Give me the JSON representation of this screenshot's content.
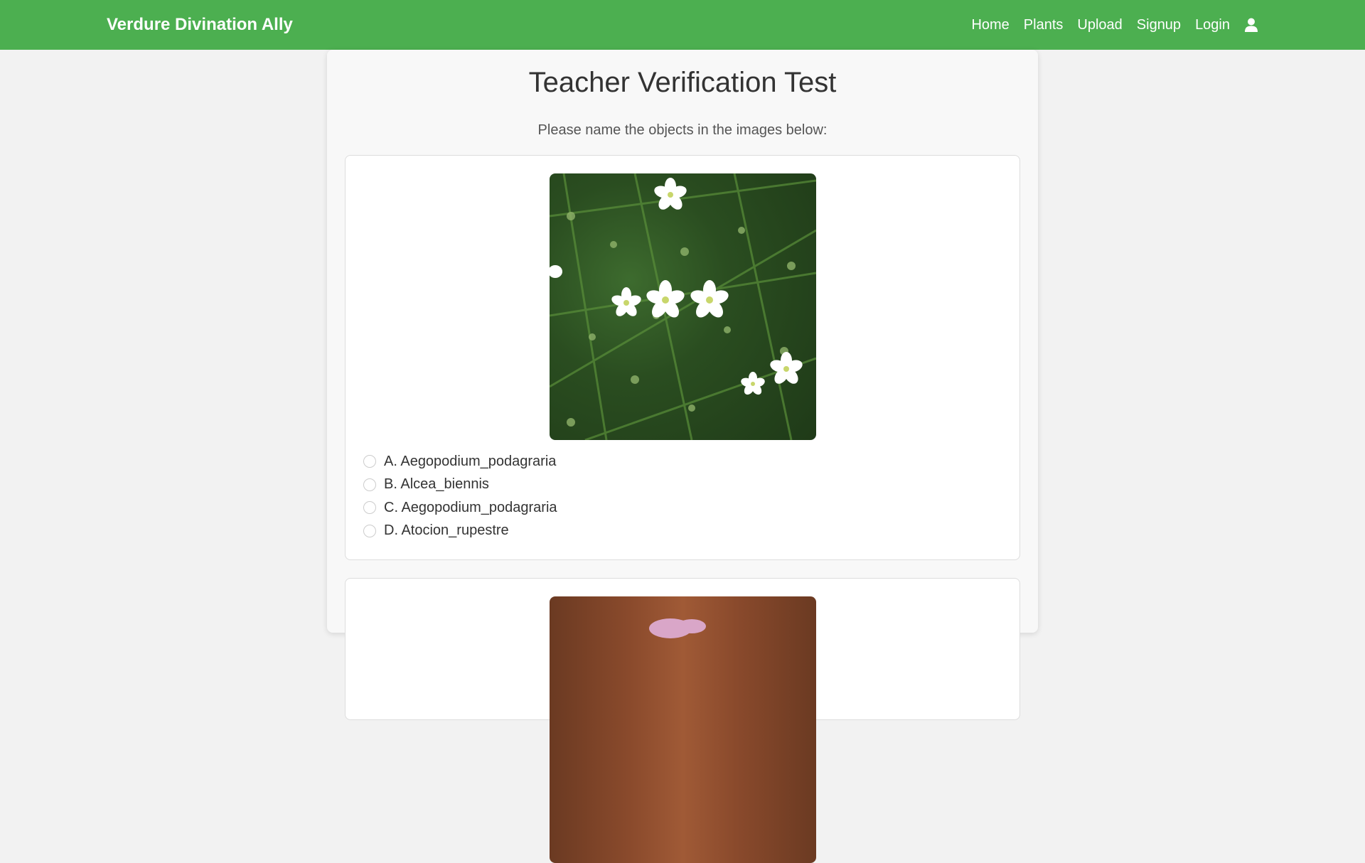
{
  "app": {
    "brand": "Verdure Divination Ally"
  },
  "nav": {
    "items": [
      {
        "label": "Home"
      },
      {
        "label": "Plants"
      },
      {
        "label": "Upload"
      },
      {
        "label": "Signup"
      },
      {
        "label": "Login"
      }
    ],
    "user_icon": "user-icon"
  },
  "page": {
    "title": "Teacher Verification Test",
    "subtitle": "Please name the objects in the images below:"
  },
  "questions": [
    {
      "image_icon": "white-flowers-photo",
      "options": [
        {
          "label": "A. Aegopodium_podagraria"
        },
        {
          "label": "B. Alcea_biennis"
        },
        {
          "label": "C. Aegopodium_podagraria"
        },
        {
          "label": "D. Atocion_rupestre"
        }
      ]
    },
    {
      "image_icon": "pink-flower-photo",
      "options": []
    }
  ],
  "colors": {
    "navbar": "#4caf50",
    "background": "#f2f2f2",
    "card": "#ffffff"
  }
}
